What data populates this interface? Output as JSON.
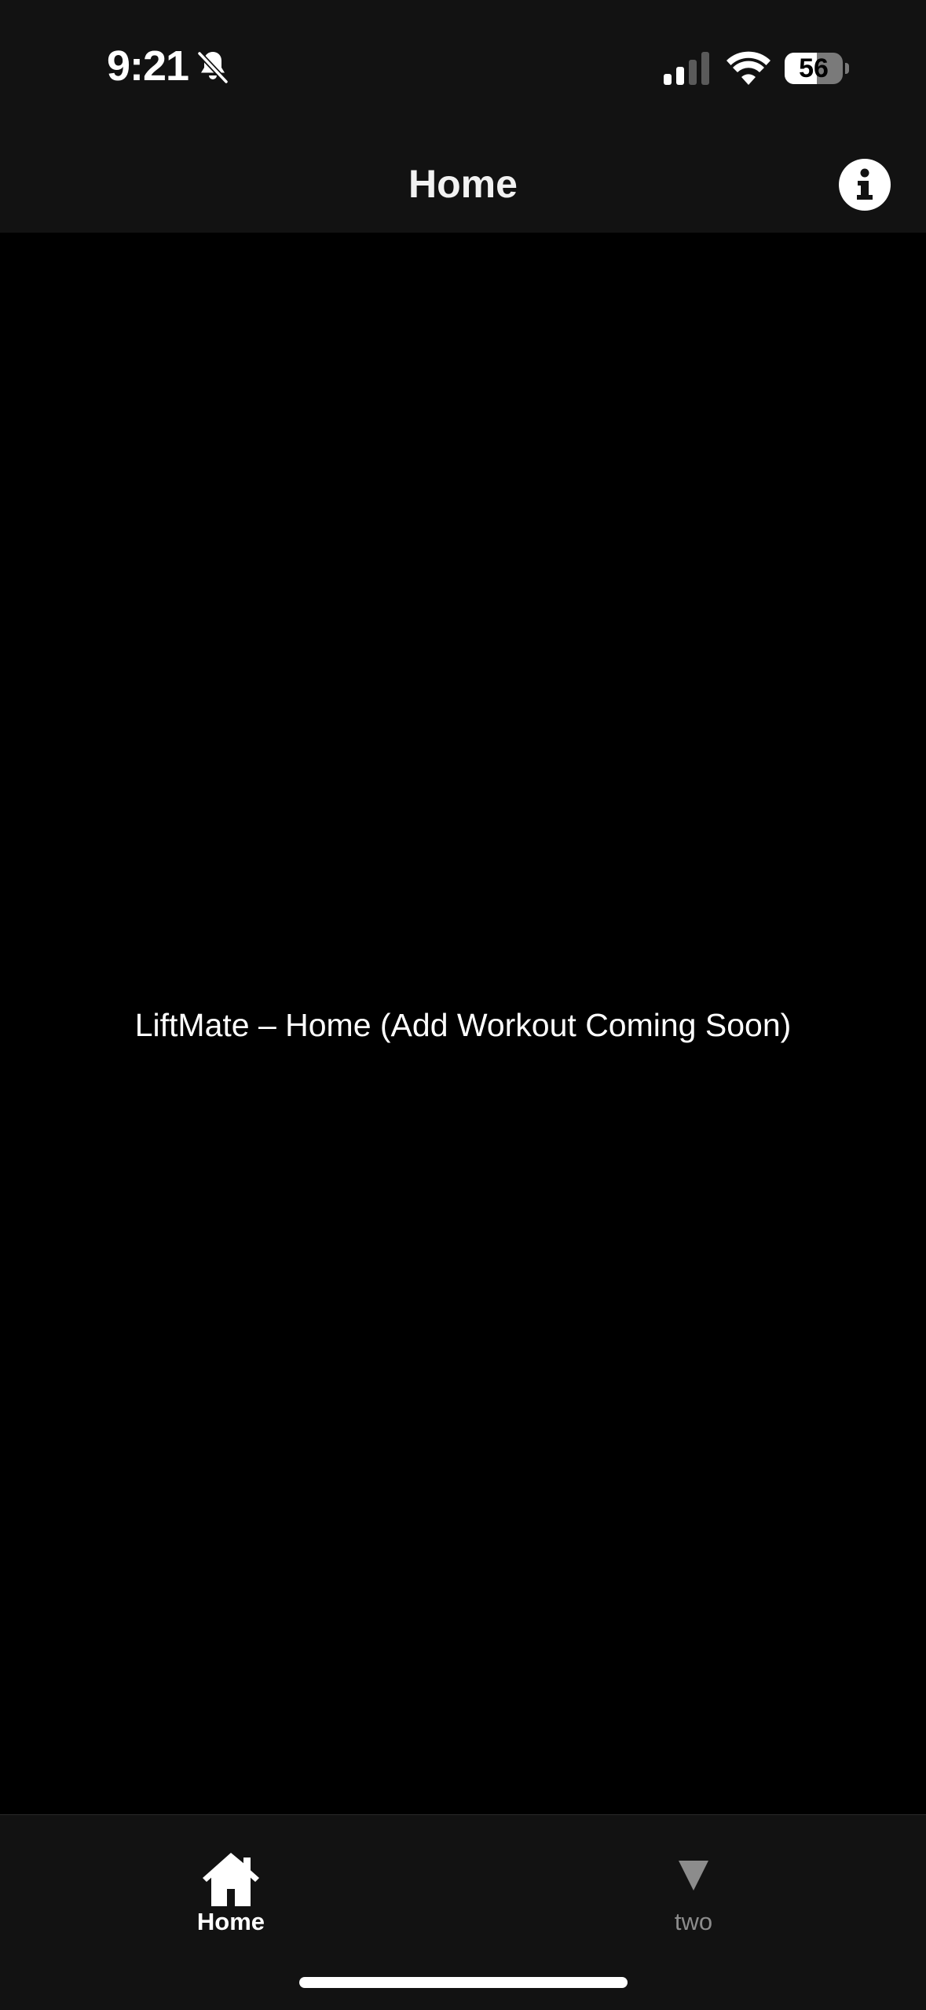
{
  "status_bar": {
    "time": "9:21",
    "battery_level": "56",
    "battery_fraction": 0.56
  },
  "header": {
    "title": "Home"
  },
  "main": {
    "placeholder": "LiftMate – Home (Add Workout Coming Soon)"
  },
  "tab_bar": {
    "tabs": [
      {
        "label": "Home",
        "icon": "house-icon",
        "active": true
      },
      {
        "label": "two",
        "icon": "triangle-down-icon",
        "active": false
      }
    ]
  },
  "colors": {
    "background": "#000000",
    "bar_background": "#121212",
    "text_primary": "#ffffff",
    "text_inactive": "#8c8c8c"
  }
}
